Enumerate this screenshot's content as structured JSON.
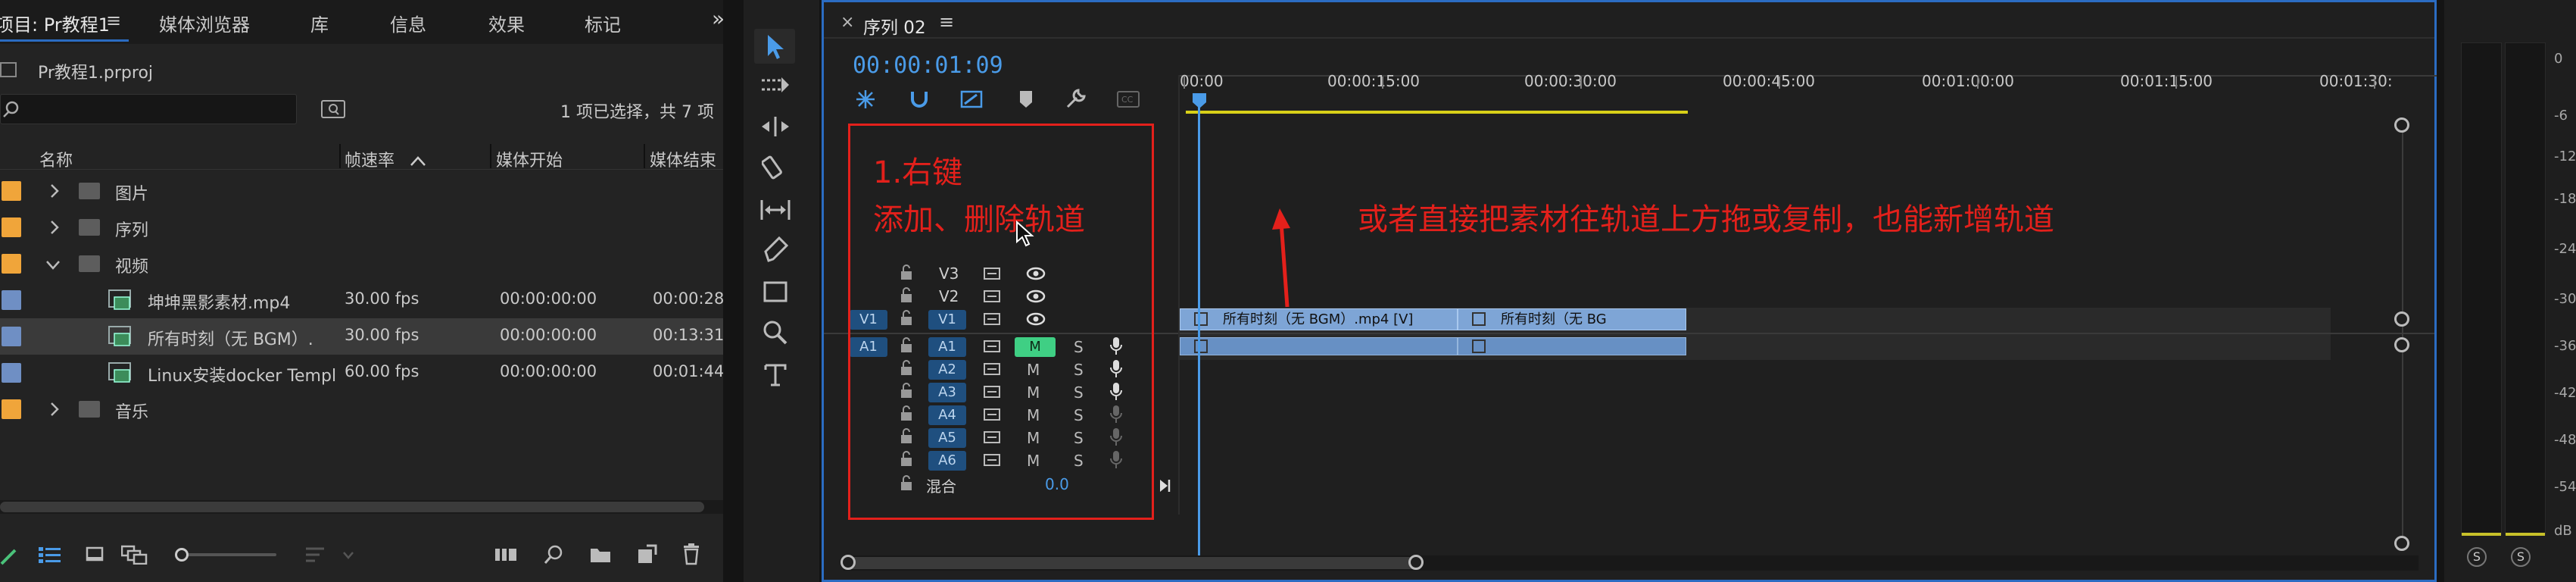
{
  "project": {
    "tabs": [
      "项目: Pr教程1",
      "媒体浏览器",
      "库",
      "信息",
      "效果",
      "标记"
    ],
    "menu_glyph": "≡",
    "more_glyph": "»",
    "file_name": "Pr教程1.prproj",
    "search_placeholder": "",
    "selection_status": "1 项已选择，共 7 项",
    "columns": [
      "名称",
      "帧速率",
      "媒体开始",
      "媒体结束"
    ],
    "rows": [
      {
        "name": "图片",
        "fps": "",
        "start": "",
        "end": ""
      },
      {
        "name": "序列",
        "fps": "",
        "start": "",
        "end": ""
      },
      {
        "name": "视频",
        "fps": "",
        "start": "",
        "end": ""
      },
      {
        "name": "坤坤黑影素材.mp4",
        "fps": "30.00 fps",
        "start": "00:00:00:00",
        "end": "00:00:28"
      },
      {
        "name": "所有时刻（无 BGM）.",
        "fps": "30.00 fps",
        "start": "00:00:00:00",
        "end": "00:13:31"
      },
      {
        "name": "Linux安装docker Templ",
        "fps": "60.00 fps",
        "start": "00:00:00:00",
        "end": "00:01:44"
      },
      {
        "name": "音乐",
        "fps": "",
        "start": "",
        "end": ""
      }
    ],
    "colors": {
      "folder_label": "#f0a53a",
      "clip_label": "#6f8fc4",
      "selected_row": "#3a3a3a"
    }
  },
  "timeline": {
    "tab_title": "序列 02",
    "close_glyph": "×",
    "menu_glyph": "≡",
    "timecode": "00:00:01:09",
    "ruler": [
      "00:00",
      "00:00:15:00",
      "00:00:30:00",
      "00:00:45:00",
      "00:01:00:00",
      "00:01:15:00",
      "00:01:30:"
    ],
    "video_tracks": [
      "V3",
      "V2",
      "V1"
    ],
    "audio_tracks": [
      "A1",
      "A2",
      "A3",
      "A4",
      "A5",
      "A6"
    ],
    "source_v": "V1",
    "source_a": "A1",
    "mix_label": "混合",
    "mix_value": "0.0",
    "m_label": "M",
    "s_label": "S",
    "clip_v1_a": "所有时刻（无 BGM）.mp4 [V]",
    "clip_v1_b": "所有时刻（无 BG",
    "annotation_step": "1.右键",
    "annotation_step2": "添加、删除轨道",
    "annotation_tip": "或者直接把素材往轨道上方拖或复制，也能新增轨道",
    "playhead_color": "#4a9be8",
    "annotation_color": "#e3201b"
  },
  "meter": {
    "labels": [
      "0",
      "-6",
      "-12",
      "-18",
      "-24",
      "-30",
      "-36",
      "-42",
      "-48",
      "-54",
      "dB"
    ],
    "solo_labels": [
      "S",
      "S"
    ]
  }
}
